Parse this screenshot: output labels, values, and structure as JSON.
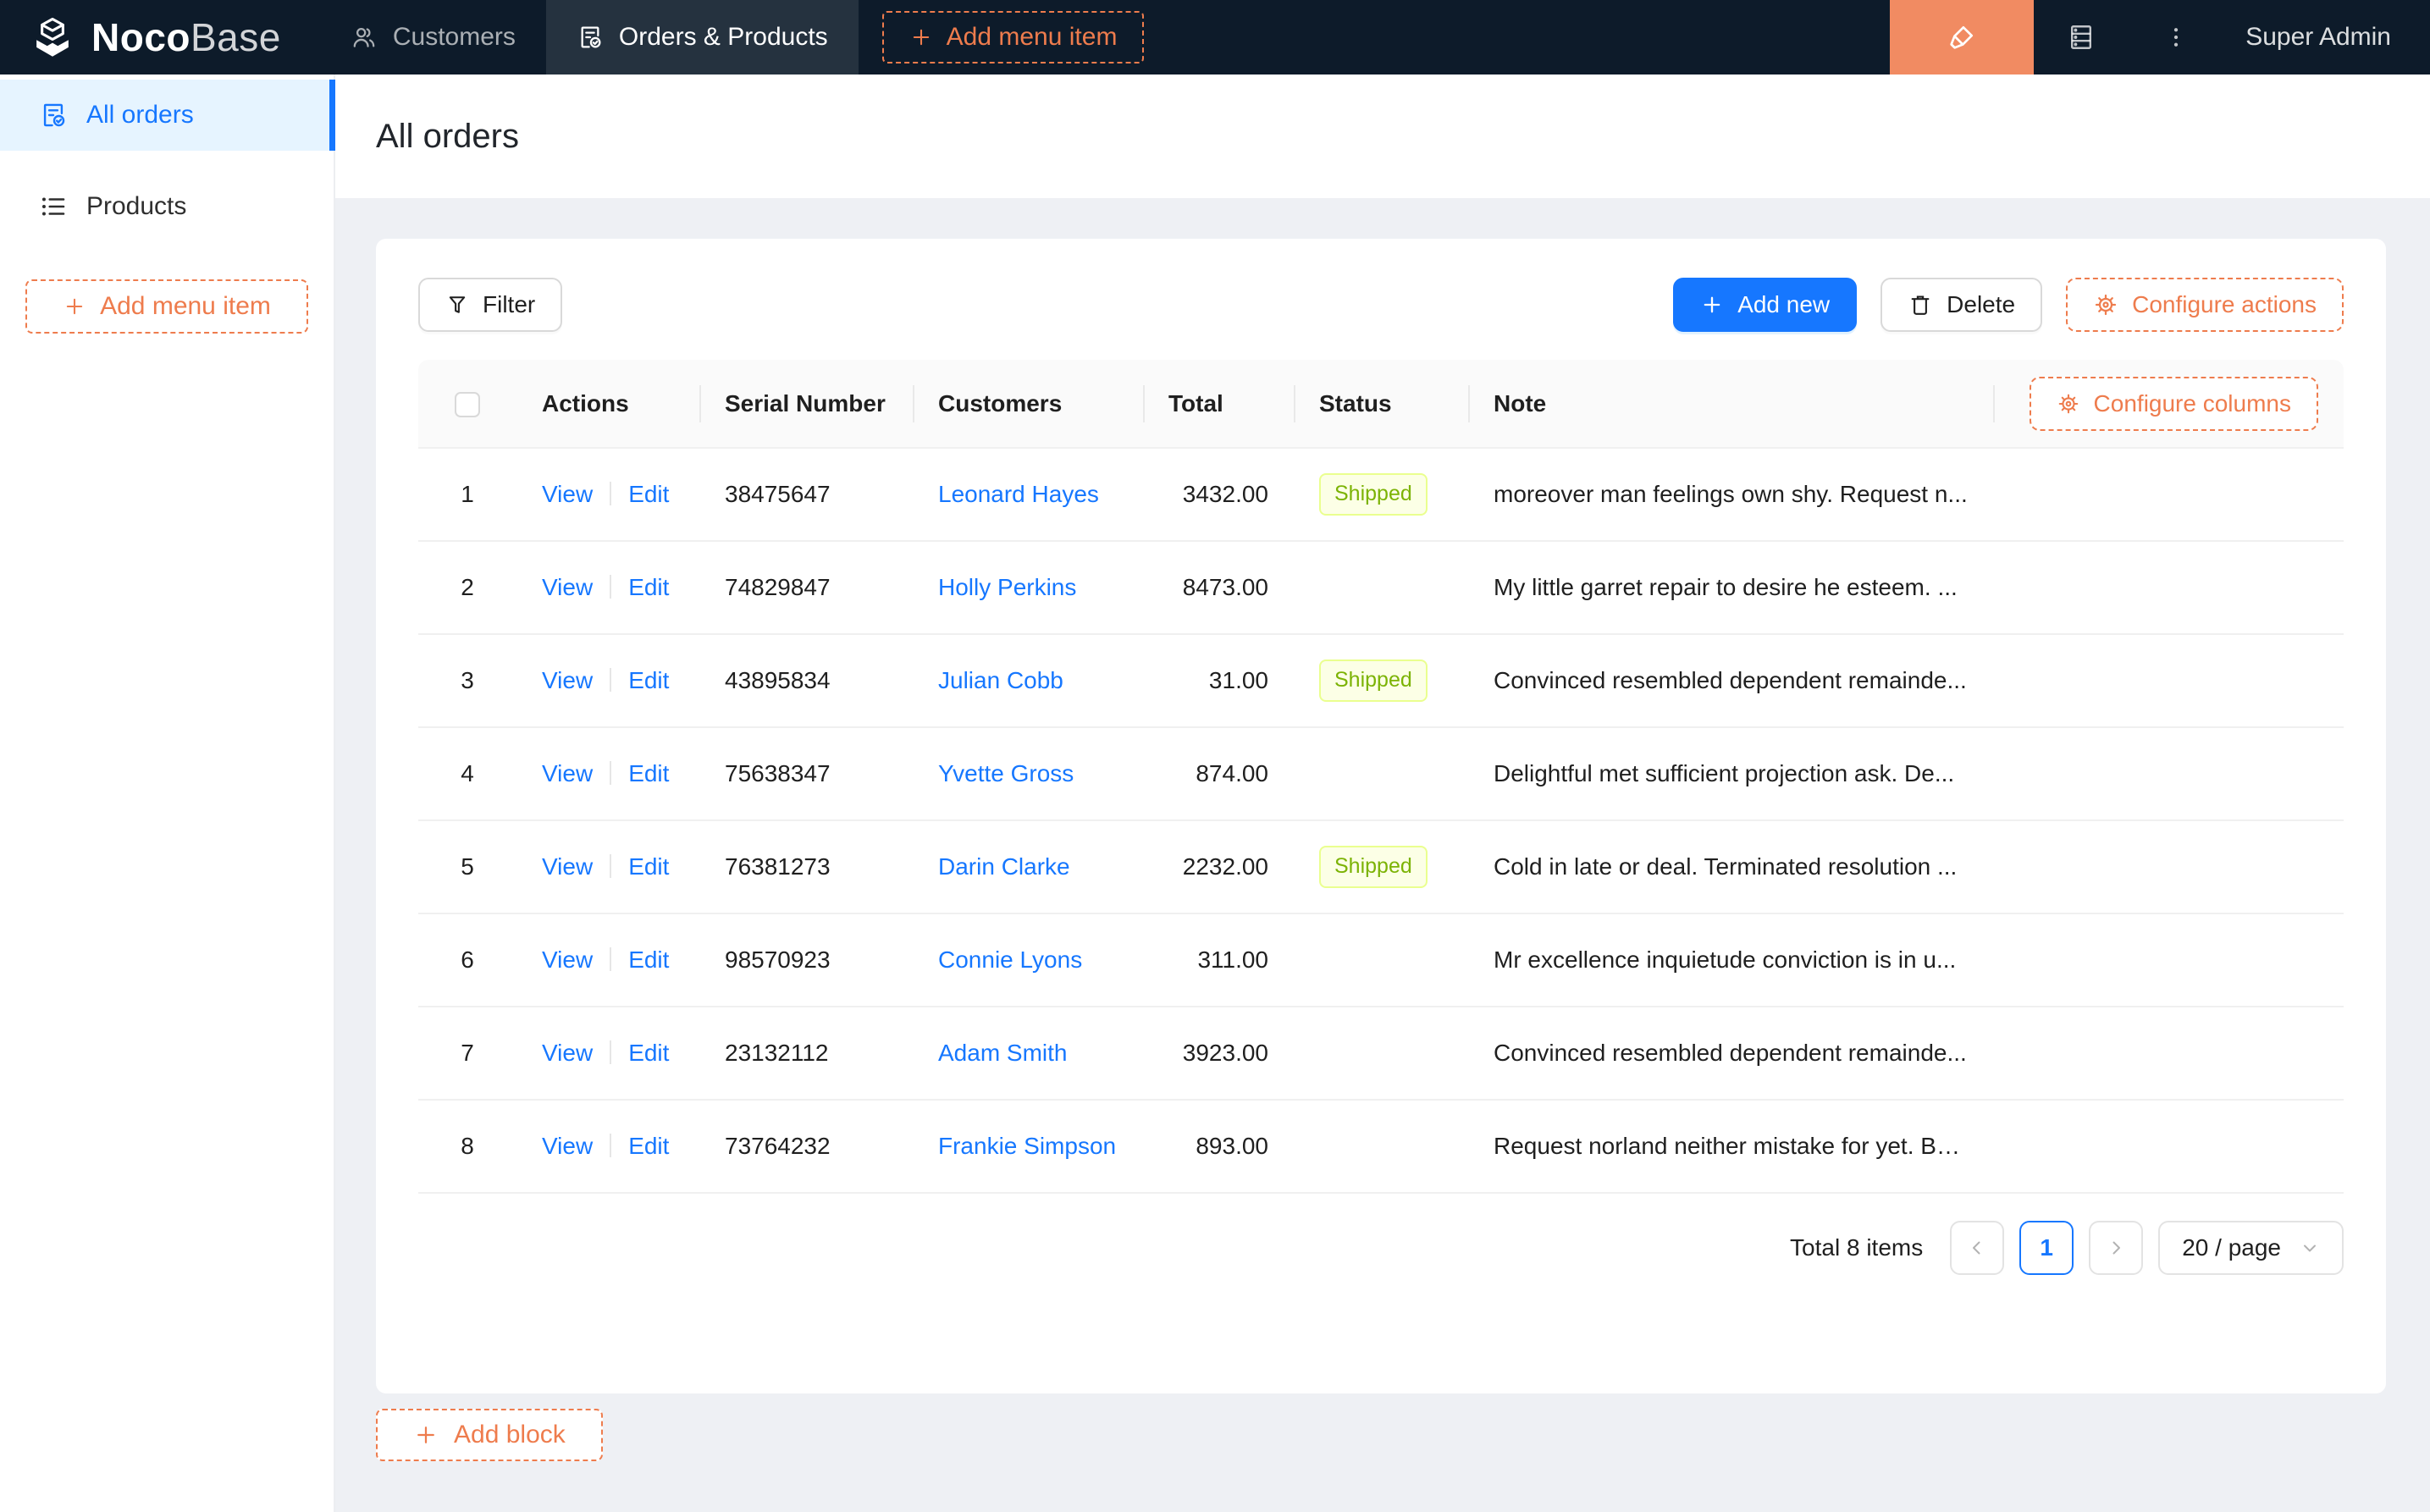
{
  "brand": {
    "name_bold": "Noco",
    "name_light": "Base"
  },
  "navbar": {
    "tabs": [
      {
        "label": "Customers"
      },
      {
        "label": "Orders & Products"
      }
    ],
    "add_menu_item_label": "+",
    "add_menu_item": "Add menu item",
    "user": "Super Admin"
  },
  "sidebar": {
    "items": [
      {
        "label": "All orders"
      },
      {
        "label": "Products"
      }
    ],
    "add_menu_item": "Add menu item"
  },
  "page": {
    "title": "All orders"
  },
  "toolbar": {
    "filter": "Filter",
    "add_new": "Add new",
    "delete": "Delete",
    "configure_actions": "Configure actions"
  },
  "table": {
    "columns": [
      "Actions",
      "Serial Number",
      "Customers",
      "Total",
      "Status",
      "Note"
    ],
    "configure_columns": "Configure columns",
    "view_label": "View",
    "edit_label": "Edit",
    "rows": [
      {
        "index": "1",
        "serial": "38475647",
        "customer": "Leonard Hayes",
        "total": "3432.00",
        "status": "Shipped",
        "note": "moreover man feelings own shy. Request n..."
      },
      {
        "index": "2",
        "serial": "74829847",
        "customer": "Holly Perkins",
        "total": "8473.00",
        "status": "",
        "note": "My little garret repair to desire he esteem. ..."
      },
      {
        "index": "3",
        "serial": "43895834",
        "customer": "Julian Cobb",
        "total": "31.00",
        "status": "Shipped",
        "note": "Convinced resembled dependent remainde..."
      },
      {
        "index": "4",
        "serial": "75638347",
        "customer": "Yvette Gross",
        "total": "874.00",
        "status": "",
        "note": "Delightful met sufficient projection ask. De..."
      },
      {
        "index": "5",
        "serial": "76381273",
        "customer": "Darin Clarke",
        "total": "2232.00",
        "status": "Shipped",
        "note": "Cold in late or deal. Terminated resolution ..."
      },
      {
        "index": "6",
        "serial": "98570923",
        "customer": "Connie Lyons",
        "total": "311.00",
        "status": "",
        "note": "Mr excellence inquietude conviction is in u..."
      },
      {
        "index": "7",
        "serial": "23132112",
        "customer": "Adam Smith",
        "total": "3923.00",
        "status": "",
        "note": "Convinced resembled dependent remainde..."
      },
      {
        "index": "8",
        "serial": "73764232",
        "customer": "Frankie Simpson",
        "total": "893.00",
        "status": "",
        "note": "Request norland neither mistake for yet. Be..."
      }
    ]
  },
  "pagination": {
    "total": "Total 8 items",
    "page": "1",
    "page_size": "20 / page"
  },
  "footer": {
    "add_block": "Add block"
  },
  "colors": {
    "navbarbg": "#0d1b2a",
    "accent": "#ee7c4d",
    "designerbg": "#f18b62",
    "primary": "#1677ff",
    "selectedbg": "#e6f4ff",
    "tagbg": "#fcffe6",
    "tagborder": "#eaff8f",
    "tagtext": "#7cb305",
    "pagebg": "#eef0f4"
  }
}
